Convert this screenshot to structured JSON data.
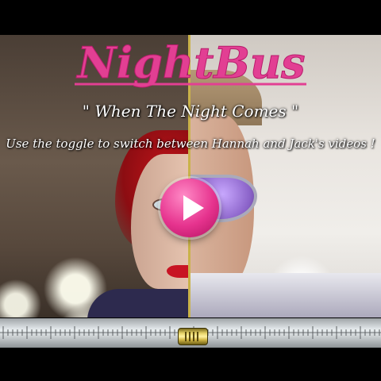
{
  "header": {
    "logo_text": "NightBus",
    "subtitle": "\" When The Night Comes \"",
    "instruction": "Use the toggle to switch between Hannah and Jack's videos !"
  },
  "video": {
    "play_icon": "play-icon",
    "left_video": "Hannah",
    "right_video": "Jack"
  },
  "toggle": {
    "knob_icon": "slider-knob-icon"
  },
  "colors": {
    "logo_pink": "#e23f93",
    "play_pink": "#e6338e",
    "divider_gold": "#c9b24a",
    "knob_gold": "#e8d46a"
  }
}
